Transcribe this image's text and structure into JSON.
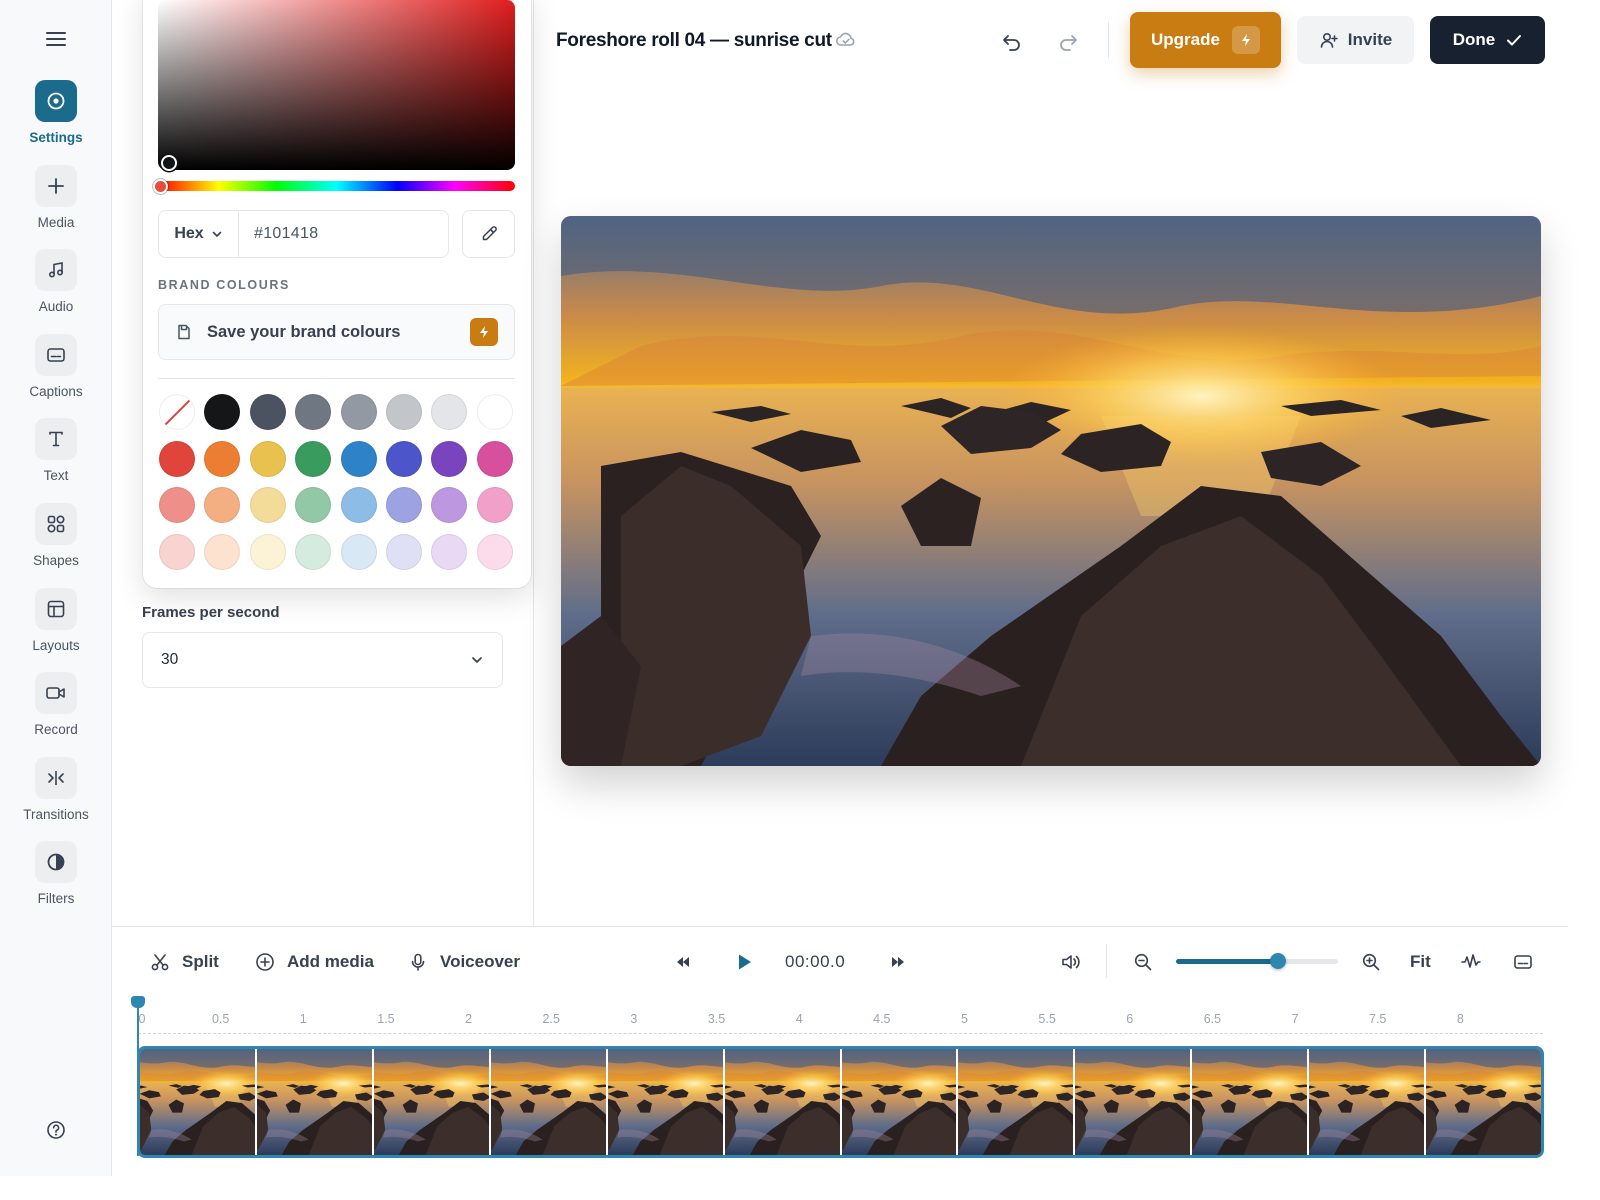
{
  "rail": {
    "items": [
      {
        "label": "Settings",
        "icon": "settings-icon"
      },
      {
        "label": "Media",
        "icon": "plus-icon"
      },
      {
        "label": "Audio",
        "icon": "music-note-icon"
      },
      {
        "label": "Captions",
        "icon": "captions-icon"
      },
      {
        "label": "Text",
        "icon": "text-icon"
      },
      {
        "label": "Shapes",
        "icon": "shapes-icon"
      },
      {
        "label": "Layouts",
        "icon": "layouts-icon"
      },
      {
        "label": "Record",
        "icon": "camera-icon"
      },
      {
        "label": "Transitions",
        "icon": "transitions-icon"
      },
      {
        "label": "Filters",
        "icon": "contrast-icon"
      }
    ],
    "active": "Settings"
  },
  "picker": {
    "mode": "Hex",
    "value": "#101418",
    "brand_heading": "BRAND COLOURS",
    "brand_cta": "Save your brand colours",
    "swatches": [
      [
        "none",
        "#141618",
        "#4b5260",
        "#6f7782",
        "#9299a2",
        "#c2c6cb",
        "#e3e5e8",
        "#ffffff"
      ],
      [
        "#e0443a",
        "#ec7e33",
        "#e8c14e",
        "#3a9b5f",
        "#2e83c8",
        "#4c55c9",
        "#7b44bf",
        "#d74f9d"
      ],
      [
        "#ef8f89",
        "#f3ae82",
        "#f3dc9a",
        "#93c8a6",
        "#8dbce6",
        "#9da2e3",
        "#bd98e0",
        "#f0a0c9"
      ],
      [
        "#f9d3d0",
        "#fde3cf",
        "#fcf3d6",
        "#d6ebdf",
        "#d8e8f5",
        "#dfe0f6",
        "#ead9f4",
        "#fcdbea"
      ]
    ]
  },
  "settings": {
    "fps_label": "Frames per second",
    "fps_value": "30"
  },
  "header": {
    "title": "Foreshore roll 04 — sunrise cut",
    "upgrade_label": "Upgrade",
    "invite_label": "Invite",
    "done_label": "Done"
  },
  "timeline": {
    "split_label": "Split",
    "add_media_label": "Add media",
    "voiceover_label": "Voiceover",
    "time": "00:00.0",
    "fit_label": "Fit",
    "zoom_level": 0.63,
    "ticks": [
      "0",
      "0.5",
      "1",
      "1.5",
      "2",
      "2.5",
      "3",
      "3.5",
      "4",
      "4.5",
      "5",
      "5.5",
      "6",
      "6.5",
      "7",
      "7.5",
      "8"
    ],
    "duration_seconds": 8.5,
    "frame_count": 12
  },
  "colors": {
    "accent": "#1b6b8c",
    "upgrade": "#c97c12",
    "done": "#172130",
    "playhead": "#2f86b0"
  }
}
